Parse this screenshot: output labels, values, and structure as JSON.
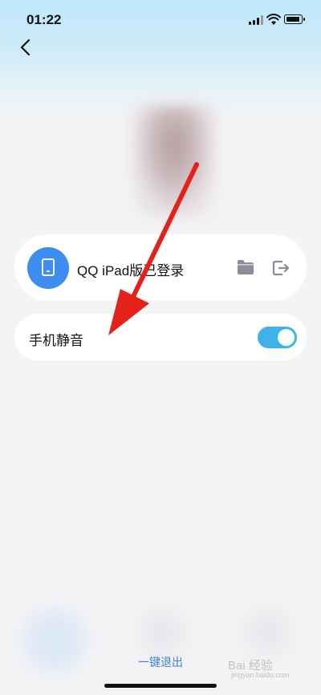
{
  "status_bar": {
    "time": "01:22"
  },
  "device_card": {
    "label": "QQ iPad版已登录"
  },
  "mute_setting": {
    "label": "手机静音",
    "enabled": true
  },
  "footer": {
    "exit_all_label": "一键退出"
  },
  "watermark": {
    "text": "Bai 经验",
    "sub": "jingyan.baidu.com"
  },
  "colors": {
    "accent": "#3d8ef0",
    "toggle_on": "#3fb2ea",
    "link": "#3b82e0",
    "annotation": "#e3231b"
  }
}
